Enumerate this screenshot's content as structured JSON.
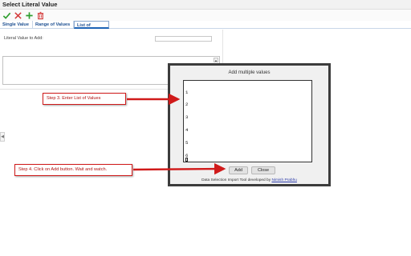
{
  "window": {
    "title": "Select Literal Value"
  },
  "toolbar": {
    "buttons": [
      {
        "name": "confirm-check-icon",
        "color": "#2e9e2e"
      },
      {
        "name": "cancel-x-icon",
        "color": "#d23232"
      },
      {
        "name": "add-plus-icon",
        "color": "#2e9e2e"
      },
      {
        "name": "delete-trash-icon",
        "color": "#d23232"
      }
    ]
  },
  "tabs": [
    {
      "label": "Single Value",
      "active": false
    },
    {
      "label": "Range of Values",
      "active": false
    },
    {
      "label": "List of Values",
      "active": true
    }
  ],
  "panel": {
    "literal_label": "Literal Value to Add:",
    "literal_value": "",
    "side_handle": "◀"
  },
  "dialog": {
    "title": "Add multiple values",
    "lines": [
      "1",
      "2",
      "3",
      "4",
      "5",
      "6"
    ],
    "add_label": "Add",
    "close_label": "Close",
    "credit_prefix": "Data Selection Import Tool developed by ",
    "credit_link": "Nimish Prabhu"
  },
  "annotations": {
    "step3": "Step 3. Enter List of Values",
    "step4": "Step 4. Click on Add button. Wait and watch.",
    "accent_color": "#d01a1a"
  }
}
